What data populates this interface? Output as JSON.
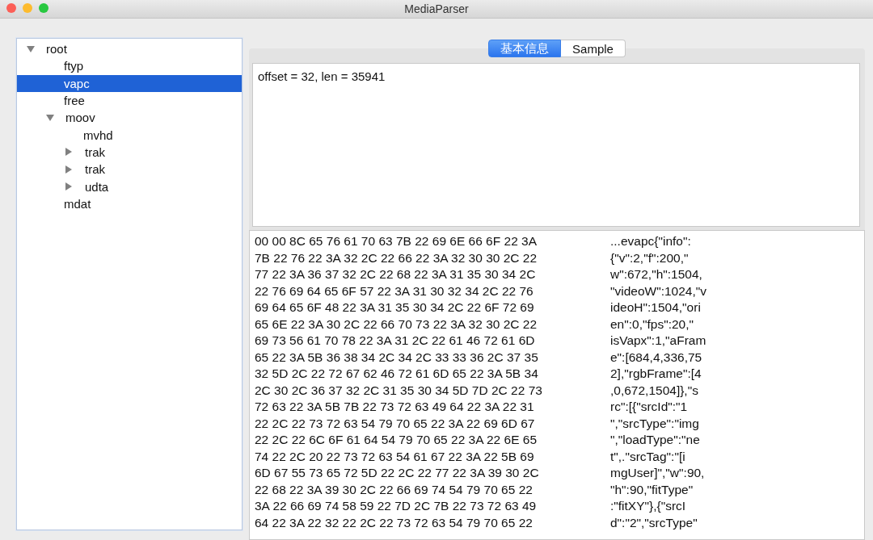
{
  "window": {
    "title": "MediaParser"
  },
  "tree": [
    {
      "label": "root",
      "expanded": true,
      "selected": false,
      "children": [
        {
          "label": "ftyp",
          "selected": false
        },
        {
          "label": "vapc",
          "selected": true
        },
        {
          "label": "free",
          "selected": false
        },
        {
          "label": "moov",
          "expanded": true,
          "selected": false,
          "children": [
            {
              "label": "mvhd",
              "selected": false
            },
            {
              "label": "trak",
              "expanded": false,
              "selected": false
            },
            {
              "label": "trak",
              "expanded": false,
              "selected": false
            },
            {
              "label": "udta",
              "expanded": false,
              "selected": false
            }
          ]
        },
        {
          "label": "mdat",
          "selected": false
        }
      ]
    }
  ],
  "tabs": [
    {
      "label": "基本信息",
      "selected": true
    },
    {
      "label": "Sample",
      "selected": false
    }
  ],
  "info": "offset = 32, len = 35941",
  "hex_rows": [
    {
      "hex": "00 00 8C 65 76 61 70 63 7B 22 69 6E 66 6F 22 3A",
      "ascii": "...evapc{\"info\":"
    },
    {
      "hex": "7B 22 76 22 3A 32 2C 22 66 22 3A 32 30 30 2C 22",
      "ascii": "{\"v\":2,\"f\":200,\""
    },
    {
      "hex": "77 22 3A 36 37 32 2C 22 68 22 3A 31 35 30 34 2C",
      "ascii": "w\":672,\"h\":1504,"
    },
    {
      "hex": "22 76 69 64 65 6F 57 22 3A 31 30 32 34 2C 22 76",
      "ascii": "\"videoW\":1024,\"v"
    },
    {
      "hex": "69 64 65 6F 48 22 3A 31 35 30 34 2C 22 6F 72 69",
      "ascii": "ideoH\":1504,\"ori"
    },
    {
      "hex": "65 6E 22 3A 30 2C 22 66 70 73 22 3A 32 30 2C 22",
      "ascii": "en\":0,\"fps\":20,\""
    },
    {
      "hex": "69 73 56 61 70 78 22 3A 31 2C 22 61 46 72 61 6D",
      "ascii": "isVapx\":1,\"aFram"
    },
    {
      "hex": "65 22 3A 5B 36 38 34 2C 34 2C 33 33 36 2C 37 35",
      "ascii": "e\":[684,4,336,75"
    },
    {
      "hex": "32 5D 2C 22 72 67 62 46 72 61 6D 65 22 3A 5B 34",
      "ascii": "2],\"rgbFrame\":[4"
    },
    {
      "hex": "2C 30 2C 36 37 32 2C 31 35 30 34 5D 7D 2C 22 73",
      "ascii": ",0,672,1504]},\"s"
    },
    {
      "hex": "72 63 22 3A 5B 7B 22 73 72 63 49 64 22 3A 22 31",
      "ascii": "rc\":[{\"srcId\":\"1"
    },
    {
      "hex": "22 2C 22 73 72 63 54 79 70 65 22 3A 22 69 6D 67",
      "ascii": "\",\"srcType\":\"img"
    },
    {
      "hex": "22 2C 22 6C 6F 61 64 54 79 70 65 22 3A 22 6E 65",
      "ascii": "\",\"loadType\":\"ne"
    },
    {
      "hex": "74 22 2C 20 22 73 72 63 54 61 67 22 3A 22 5B 69",
      "ascii": "t\",.\"srcTag\":\"[i"
    },
    {
      "hex": "6D 67 55 73 65 72 5D 22 2C 22 77 22 3A 39 30 2C",
      "ascii": "mgUser]\",\"w\":90,"
    },
    {
      "hex": "22 68 22 3A 39 30 2C 22 66 69 74 54 79 70 65 22",
      "ascii": "\"h\":90,\"fitType\""
    },
    {
      "hex": "3A 22 66 69 74 58 59 22 7D 2C 7B 22 73 72 63 49",
      "ascii": ":\"fitXY\"},{\"srcI"
    },
    {
      "hex": "64 22 3A 22 32 22 2C 22 73 72 63 54 79 70 65 22",
      "ascii": "d\":\"2\",\"srcType\""
    }
  ]
}
